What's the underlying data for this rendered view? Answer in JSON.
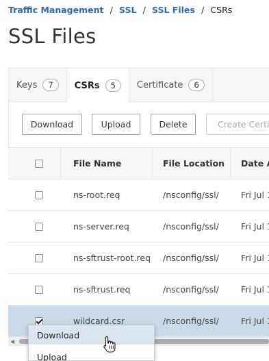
{
  "breadcrumb": {
    "items": [
      "Traffic Management",
      "SSL",
      "SSL Files"
    ],
    "separator": "/",
    "current": "CSRs"
  },
  "page": {
    "title": "SSL Files"
  },
  "tabs": [
    {
      "label": "Keys",
      "count": "7",
      "active": false
    },
    {
      "label": "CSRs",
      "count": "5",
      "active": true
    },
    {
      "label": "Certificate",
      "count": "6",
      "active": false
    }
  ],
  "toolbar": {
    "download_label": "Download",
    "upload_label": "Upload",
    "delete_label": "Delete",
    "create_label": "Create Certificate"
  },
  "table": {
    "headers": {
      "file_name": "File Name",
      "file_location": "File Location",
      "date": "Date Ad"
    },
    "rows": [
      {
        "file_name": "ns-root.req",
        "file_location": "/nsconfig/ssl/",
        "date": "Fri Jul  1",
        "checked": false
      },
      {
        "file_name": "ns-server.req",
        "file_location": "/nsconfig/ssl/",
        "date": "Fri Jul  1",
        "checked": false
      },
      {
        "file_name": "ns-sftrust-root.req",
        "file_location": "/nsconfig/ssl/",
        "date": "Fri Jul  1",
        "checked": false
      },
      {
        "file_name": "ns-sftrust.req",
        "file_location": "/nsconfig/ssl/",
        "date": "Fri Jul  1",
        "checked": false
      },
      {
        "file_name": "wildcard.csr",
        "file_location": "/nsconfig/ssl/",
        "date": "Fri Jul  1",
        "checked": true
      }
    ]
  },
  "context_menu": {
    "items": [
      "Download",
      "Upload"
    ],
    "hovered": "Download"
  },
  "colors": {
    "link": "#2f6aa8",
    "selected_row": "#c9dbe8",
    "menu_hover": "#dbe6f0",
    "header_bg": "#f5f6f8"
  },
  "icons": {
    "checkbox": "checkbox-icon",
    "cursor": "hand-pointer-icon",
    "scroll_left": "caret-left-icon"
  }
}
